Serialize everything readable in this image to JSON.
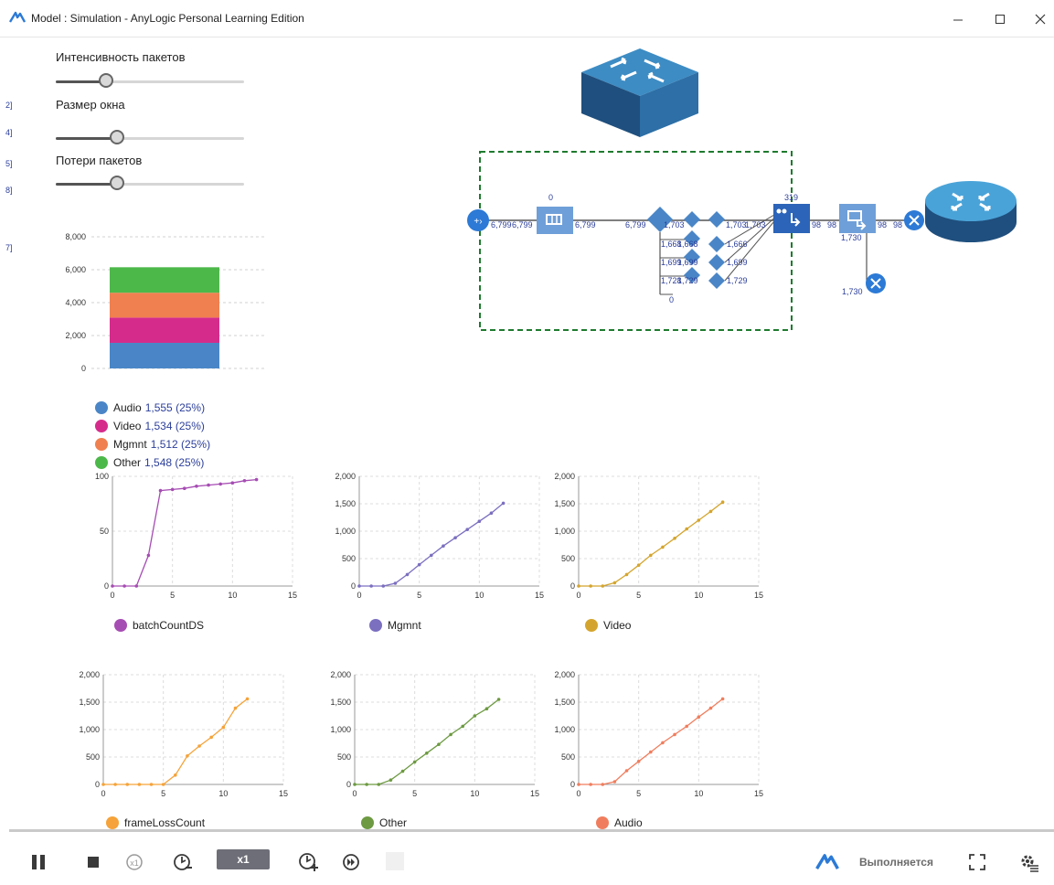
{
  "window": {
    "title": "Model : Simulation - AnyLogic Personal Learning Edition",
    "minimize_icon": "minimize-icon",
    "maximize_icon": "maximize-icon",
    "close_icon": "close-icon"
  },
  "side_ticks": [
    "2]",
    "4]",
    "5]",
    "8]",
    "7]"
  ],
  "params": [
    {
      "label": "Интенсивность пакетов",
      "value": 0.27
    },
    {
      "label": "Размер окна",
      "value": 0.33
    },
    {
      "label": "Потери пакетов",
      "value": 0.33
    }
  ],
  "stacked": {
    "yticks": [
      "8,000",
      "6,000",
      "4,000",
      "2,000",
      "0"
    ],
    "ymax": 8000,
    "segments": [
      {
        "name": "Audio",
        "value": 1555,
        "label": "1,555 (25%)",
        "color": "#4a86c7"
      },
      {
        "name": "Video",
        "value": 1534,
        "label": "1,534 (25%)",
        "color": "#d52c8c"
      },
      {
        "name": "Mgmnt",
        "value": 1512,
        "label": "1,512 (25%)",
        "color": "#f08050"
      },
      {
        "name": "Other",
        "value": 1548,
        "label": "1,548 (25%)",
        "color": "#4db84a"
      }
    ]
  },
  "flow": {
    "labels": {
      "source_out": "6,799",
      "queue_in": "6,799",
      "queue_top": "0",
      "queue_out": "6,799",
      "split_in": "6,799",
      "mid_a": "1,703",
      "mid_b": "1,703",
      "mid_c": "1,703",
      "mid_d": "1,666",
      "mid_e": "1,699",
      "mid_f": "1,729",
      "branch_a": "1,668",
      "branch_b": "1,668",
      "branch_c": "1,699",
      "branch_d": "1,699",
      "branch_e": "1,728",
      "branch_f": "1,729",
      "branch_zero": "0",
      "combine_top": "319",
      "combine_out_a": "98",
      "combine_out_b": "98",
      "delay_bottom": "1,730",
      "sink_out": "98",
      "sink_out2": "98",
      "loss": "1,730"
    }
  },
  "chart_data": [
    {
      "type": "line",
      "name": "batchCountDS",
      "color": "#a64db3",
      "xlim": [
        0,
        15
      ],
      "ylim": [
        0,
        100
      ],
      "xticks": [
        "0",
        "5",
        "10",
        "15"
      ],
      "yticks": [
        "100",
        "50",
        "0"
      ],
      "x": [
        0,
        1,
        2,
        3,
        4,
        5,
        6,
        7,
        8,
        9,
        10,
        11,
        12
      ],
      "y": [
        0,
        0,
        0,
        28,
        87,
        88,
        89,
        91,
        92,
        93,
        94,
        96,
        97
      ]
    },
    {
      "type": "line",
      "name": "Mgmnt",
      "color": "#7b6fc0",
      "xlim": [
        0,
        15
      ],
      "ylim": [
        0,
        2000
      ],
      "xticks": [
        "0",
        "5",
        "10",
        "15"
      ],
      "yticks": [
        "2,000",
        "1,500",
        "1,000",
        "500",
        "0"
      ],
      "x": [
        0,
        1,
        2,
        3,
        4,
        5,
        6,
        7,
        8,
        9,
        10,
        11,
        12
      ],
      "y": [
        0,
        0,
        0,
        50,
        210,
        390,
        560,
        730,
        880,
        1030,
        1180,
        1330,
        1510
      ]
    },
    {
      "type": "line",
      "name": "Video",
      "color": "#d4a52e",
      "xlim": [
        0,
        15
      ],
      "ylim": [
        0,
        2000
      ],
      "xticks": [
        "0",
        "5",
        "10",
        "15"
      ],
      "yticks": [
        "2,000",
        "1,500",
        "1,000",
        "500",
        "0"
      ],
      "x": [
        0,
        1,
        2,
        3,
        4,
        5,
        6,
        7,
        8,
        9,
        10,
        11,
        12
      ],
      "y": [
        0,
        0,
        0,
        60,
        210,
        380,
        560,
        710,
        870,
        1040,
        1200,
        1360,
        1530
      ]
    },
    {
      "type": "line",
      "name": "frameLossCount",
      "color": "#f5a33a",
      "xlim": [
        0,
        15
      ],
      "ylim": [
        0,
        2000
      ],
      "xticks": [
        "0",
        "5",
        "10",
        "15"
      ],
      "yticks": [
        "2,000",
        "1,500",
        "1,000",
        "500",
        "0"
      ],
      "x": [
        0,
        1,
        2,
        3,
        4,
        5,
        6,
        7,
        8,
        9,
        10,
        11,
        12
      ],
      "y": [
        0,
        0,
        0,
        0,
        0,
        0,
        170,
        520,
        700,
        860,
        1040,
        1390,
        1560
      ]
    },
    {
      "type": "line",
      "name": "Other",
      "color": "#6d9a42",
      "xlim": [
        0,
        15
      ],
      "ylim": [
        0,
        2000
      ],
      "xticks": [
        "0",
        "5",
        "10",
        "15"
      ],
      "yticks": [
        "2,000",
        "1,500",
        "1,000",
        "500",
        "0"
      ],
      "x": [
        0,
        1,
        2,
        3,
        4,
        5,
        6,
        7,
        8,
        9,
        10,
        11,
        12
      ],
      "y": [
        0,
        0,
        0,
        80,
        240,
        410,
        570,
        730,
        910,
        1060,
        1250,
        1380,
        1550
      ]
    },
    {
      "type": "line",
      "name": "Audio",
      "color": "#f07e5e",
      "xlim": [
        0,
        15
      ],
      "ylim": [
        0,
        2000
      ],
      "xticks": [
        "0",
        "5",
        "10",
        "15"
      ],
      "yticks": [
        "2,000",
        "1,500",
        "1,000",
        "500",
        "0"
      ],
      "x": [
        0,
        1,
        2,
        3,
        4,
        5,
        6,
        7,
        8,
        9,
        10,
        11,
        12
      ],
      "y": [
        0,
        0,
        0,
        50,
        250,
        420,
        590,
        760,
        910,
        1060,
        1230,
        1390,
        1560
      ]
    }
  ],
  "toolbar": {
    "speed_label": "x1",
    "status_label": "Выполняется"
  },
  "colors": {
    "accent": "#2c7ad6",
    "slider_knob": "#666666",
    "frame_dash": "#1e7a2e"
  }
}
